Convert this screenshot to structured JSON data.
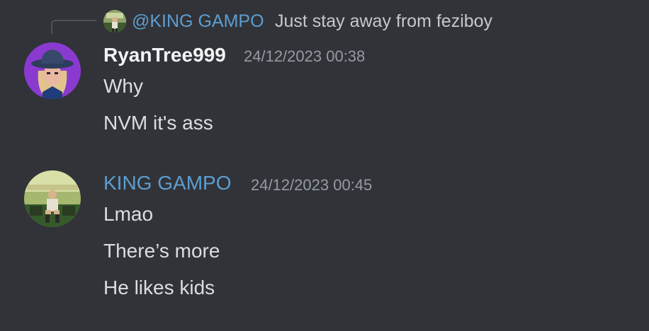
{
  "reply": {
    "author": "@KING GAMPO",
    "text": "Just stay away from feziboy"
  },
  "messages": [
    {
      "author": "RyanTree999",
      "timestamp": "24/12/2023 00:38",
      "lines": [
        "Why",
        "NVM it's ass"
      ]
    },
    {
      "author": "KING GAMPO",
      "timestamp": "24/12/2023 00:45",
      "lines": [
        "Lmao",
        "There’s more",
        "He likes kids"
      ]
    }
  ],
  "colors": {
    "background": "#313338",
    "text": "#dbdee1",
    "mention_role_blue": "#5d9ed1",
    "timestamp": "#949ba4",
    "username_default": "#f2f3f5"
  }
}
